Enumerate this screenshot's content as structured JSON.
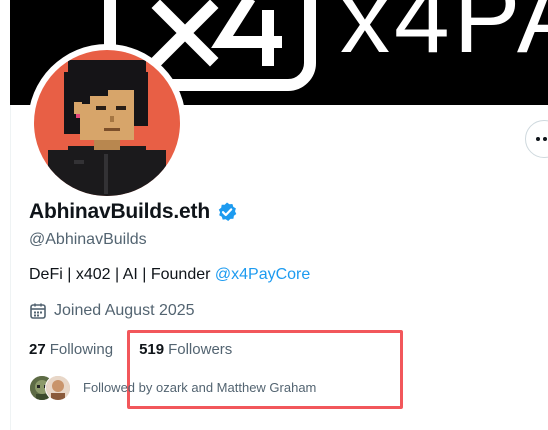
{
  "banner": {
    "text": "x4PA"
  },
  "profile": {
    "display_name": "AbhinavBuilds.eth",
    "handle": "@AbhinavBuilds",
    "bio_text": "DeFi | x402 | AI | Founder ",
    "bio_mention": "@x4PayCore",
    "joined": "Joined August 2025"
  },
  "stats": {
    "following_count": "27",
    "following_label": "Following",
    "followers_count": "519",
    "followers_label": "Followers"
  },
  "followed_by": "Followed by ozark and Matthew Graham",
  "icons": {
    "verified": "verified-badge-icon",
    "calendar": "calendar-icon",
    "more": "more-options-icon"
  },
  "colors": {
    "accent": "#1d9bf0",
    "highlight_box": "#f2575b",
    "avatar_bg": "#e85f45"
  }
}
